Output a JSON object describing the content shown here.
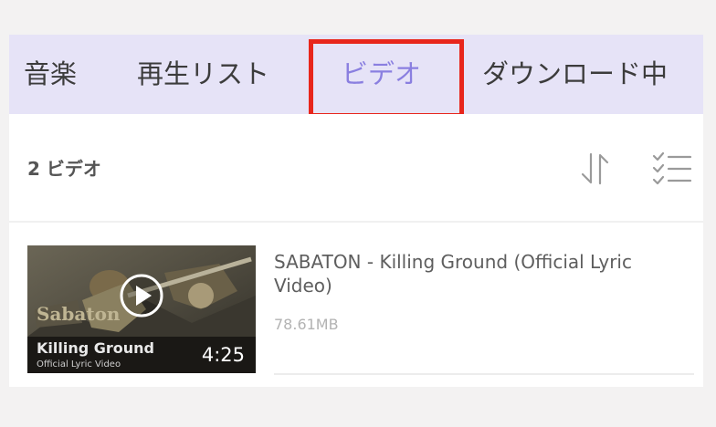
{
  "tabs": {
    "music": "音楽",
    "playlist": "再生リスト",
    "video": "ビデオ",
    "downloading": "ダウンロード中"
  },
  "active_tab": "video",
  "list_header": {
    "count_label": "2 ビデオ",
    "sort_icon": "sort-icon",
    "select_icon": "checklist-icon"
  },
  "videos": [
    {
      "title": "SABATON - Killing Ground (Official Lyric Video)",
      "size": "78.61MB",
      "duration": "4:25",
      "thumb_title": "Killing Ground",
      "thumb_subtitle": "Official Lyric Video"
    }
  ],
  "colors": {
    "tab_bar_bg": "#e6e3f7",
    "active_tab": "#8a7fe0",
    "highlight": "#e8261c"
  }
}
